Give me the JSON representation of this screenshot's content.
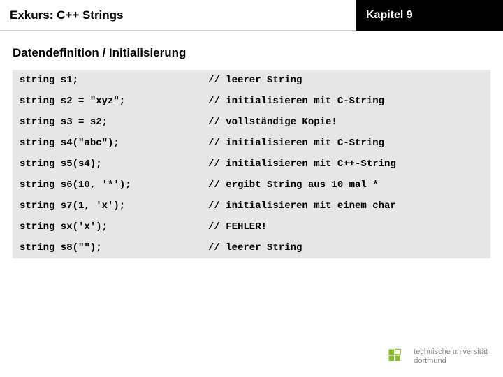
{
  "header": {
    "title_left": "Exkurs: C++ Strings",
    "title_right": "Kapitel 9"
  },
  "section_title": "Datendefinition / Initialisierung",
  "code_rows": [
    {
      "code": "string s1;",
      "comment": "// leerer String"
    },
    {
      "code": "string s2 = \"xyz\";",
      "comment": "// initialisieren mit C-String"
    },
    {
      "code": "string s3 = s2;",
      "comment": "// vollständige Kopie!"
    },
    {
      "code": "string s4(\"abc\");",
      "comment": "// initialisieren mit C-String"
    },
    {
      "code": "string s5(s4);",
      "comment": "// initialisieren mit C++-String"
    },
    {
      "code": "string s6(10, '*');",
      "comment": "// ergibt String aus 10 mal *"
    },
    {
      "code": "string s7(1, 'x');",
      "comment": "// initialisieren mit einem char"
    },
    {
      "code": "string sx('x');",
      "comment": "// FEHLER!"
    },
    {
      "code": "string s8(\"\");",
      "comment": "// leerer String"
    }
  ],
  "footer": {
    "line1": "technische universität",
    "line2": "dortmund"
  }
}
